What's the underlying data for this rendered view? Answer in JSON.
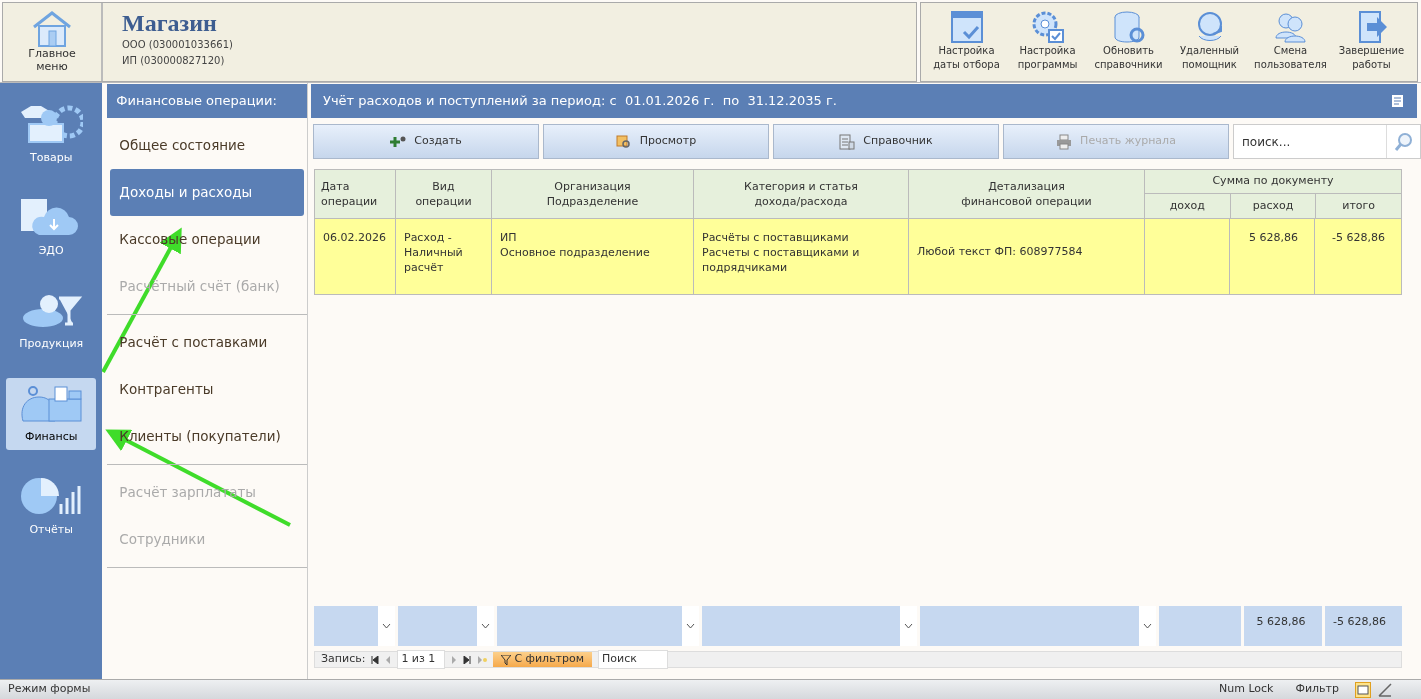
{
  "header": {
    "home": "Главное меню",
    "title": "Магазин",
    "orgs": [
      "ООО (030001033661)",
      "ИП (030000827120)"
    ],
    "tools": [
      {
        "kind": "calendar",
        "label": "Настройка даты отбора"
      },
      {
        "kind": "gear",
        "label": "Настройка программы"
      },
      {
        "kind": "database",
        "label": "Обновить справочники"
      },
      {
        "kind": "helper",
        "label": "Удаленный помощник"
      },
      {
        "kind": "users",
        "label": "Смена пользователя"
      },
      {
        "kind": "exit",
        "label": "Завершение работы"
      }
    ]
  },
  "sidebar": {
    "items": [
      {
        "kind": "goods",
        "label": "Товары",
        "selected": false
      },
      {
        "kind": "edo",
        "label": "ЭДО",
        "selected": false
      },
      {
        "kind": "product",
        "label": "Продукция",
        "selected": false
      },
      {
        "kind": "finance",
        "label": "Финансы",
        "selected": true
      },
      {
        "kind": "reports",
        "label": "Отчёты",
        "selected": false
      }
    ]
  },
  "menu": {
    "title": "Финансовые операции:",
    "groups": [
      [
        {
          "label": "Общее состояние",
          "selected": false,
          "disabled": false
        },
        {
          "label": "Доходы и расходы",
          "selected": true,
          "disabled": false
        },
        {
          "label": "Кассовые операции",
          "selected": false,
          "disabled": false
        },
        {
          "label": "Расчётный счёт (банк)",
          "selected": false,
          "disabled": true
        }
      ],
      [
        {
          "label": "Расчёт с поставками",
          "selected": false,
          "disabled": false
        },
        {
          "label": "Контрагенты",
          "selected": false,
          "disabled": false
        },
        {
          "label": "Клиенты (покупатели)",
          "selected": false,
          "disabled": false
        }
      ],
      [
        {
          "label": "Расчёт зарплататы",
          "selected": false,
          "disabled": true
        },
        {
          "label": "Сотрудники",
          "selected": false,
          "disabled": true
        }
      ]
    ]
  },
  "main": {
    "title": "Учёт расходов и поступлений за период: с  01.01.2026 г.  по  31.12.2035 г.",
    "toolbar": [
      {
        "kind": "create",
        "label": "Создать",
        "disabled": false
      },
      {
        "kind": "view",
        "label": "Просмотр",
        "disabled": false
      },
      {
        "kind": "reference",
        "label": "Справочник",
        "disabled": false
      },
      {
        "kind": "print",
        "label": "Печать журнала",
        "disabled": true
      }
    ],
    "search": {
      "placeholder": "поиск..."
    },
    "table": {
      "columns": [
        "Дата\nоперации",
        "Вид\nоперации",
        "Организация\nПодразделение",
        "Категория и статья\nдохода/расхода",
        "Детализация\nфинансовой операции"
      ],
      "group": "Сумма по документу",
      "subcolumns": [
        "доход",
        "расход",
        "итого"
      ],
      "rows": [
        {
          "cells": [
            "06.02.2026",
            "Расход - Наличный расчёт",
            "ИП\nОсновное подразделение",
            "Расчёты с поставщиками\nРасчеты с поставщиками и подрядчиками",
            "Любой текст ФП: 608977584",
            "",
            "5 628,86",
            "-5 628,86"
          ]
        }
      ],
      "totals": [
        "5 628,86",
        "-5 628,86"
      ]
    },
    "nav": {
      "label": "Запись:",
      "position": "1 из 1",
      "filter": "С фильтром",
      "search": "Поиск"
    }
  },
  "status_bar": {
    "mode": "Режим формы",
    "numlock": "Num Lock",
    "filter": "Фильтр"
  },
  "annotations": [
    {
      "kind": "arrow"
    },
    {
      "kind": "arrow"
    }
  ]
}
